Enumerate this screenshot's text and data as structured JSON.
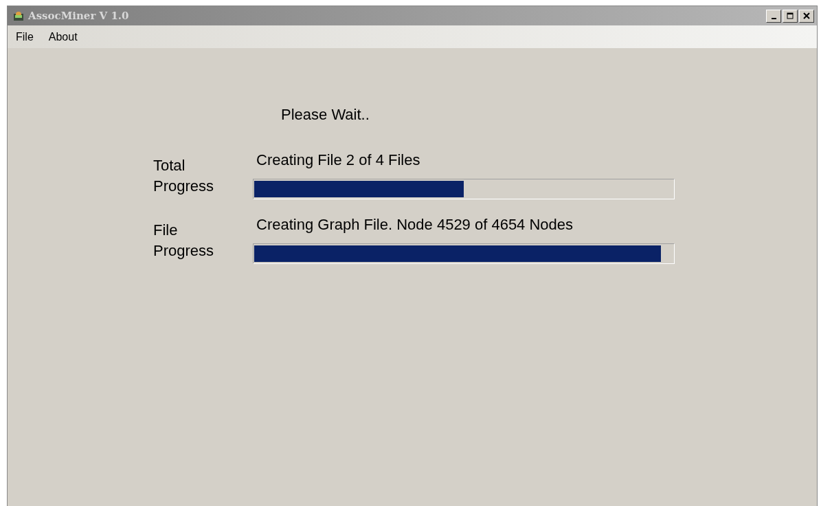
{
  "window": {
    "title": "AssocMiner V 1.0"
  },
  "menu": [
    "File",
    "About"
  ],
  "message": "Please Wait..",
  "progress": [
    {
      "label": "Total Progress",
      "status": "Creating File 2 of 4 Files",
      "level": 0.5
    },
    {
      "label": "File Progress",
      "status": "Creating Graph File. Node 4529 of 4654 Nodes",
      "level": 0.97
    }
  ]
}
